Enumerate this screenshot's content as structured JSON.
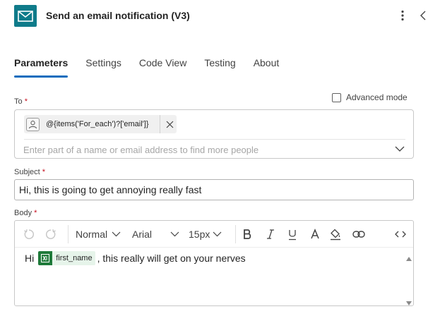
{
  "header": {
    "title": "Send an email notification (V3)"
  },
  "tabs": [
    {
      "label": "Parameters"
    },
    {
      "label": "Settings"
    },
    {
      "label": "Code View"
    },
    {
      "label": "Testing"
    },
    {
      "label": "About"
    }
  ],
  "to": {
    "label": "To",
    "required_mark": "*",
    "token_text": "@{items('For_each')?['email']}",
    "placeholder": "Enter part of a name or email address to find more people"
  },
  "advanced_mode": {
    "label": "Advanced mode",
    "checked": false
  },
  "subject": {
    "label": "Subject",
    "required_mark": "*",
    "value": "Hi, this is going to get annoying really fast"
  },
  "body": {
    "label": "Body",
    "required_mark": "*",
    "toolbar": {
      "format": "Normal",
      "font": "Arial",
      "size": "15px"
    },
    "content": {
      "prefix": "Hi",
      "token": "first_name",
      "suffix": ", this really will get on your nerves"
    }
  },
  "colors": {
    "accent": "#0f6cbd",
    "app_icon_bg": "#0f7b8a",
    "excel_green": "#1f7a3a",
    "required": "#c50f1f"
  },
  "icons": {
    "app": "mail-icon",
    "more": "more-vertical-icon",
    "collapse": "chevron-left-icon"
  }
}
